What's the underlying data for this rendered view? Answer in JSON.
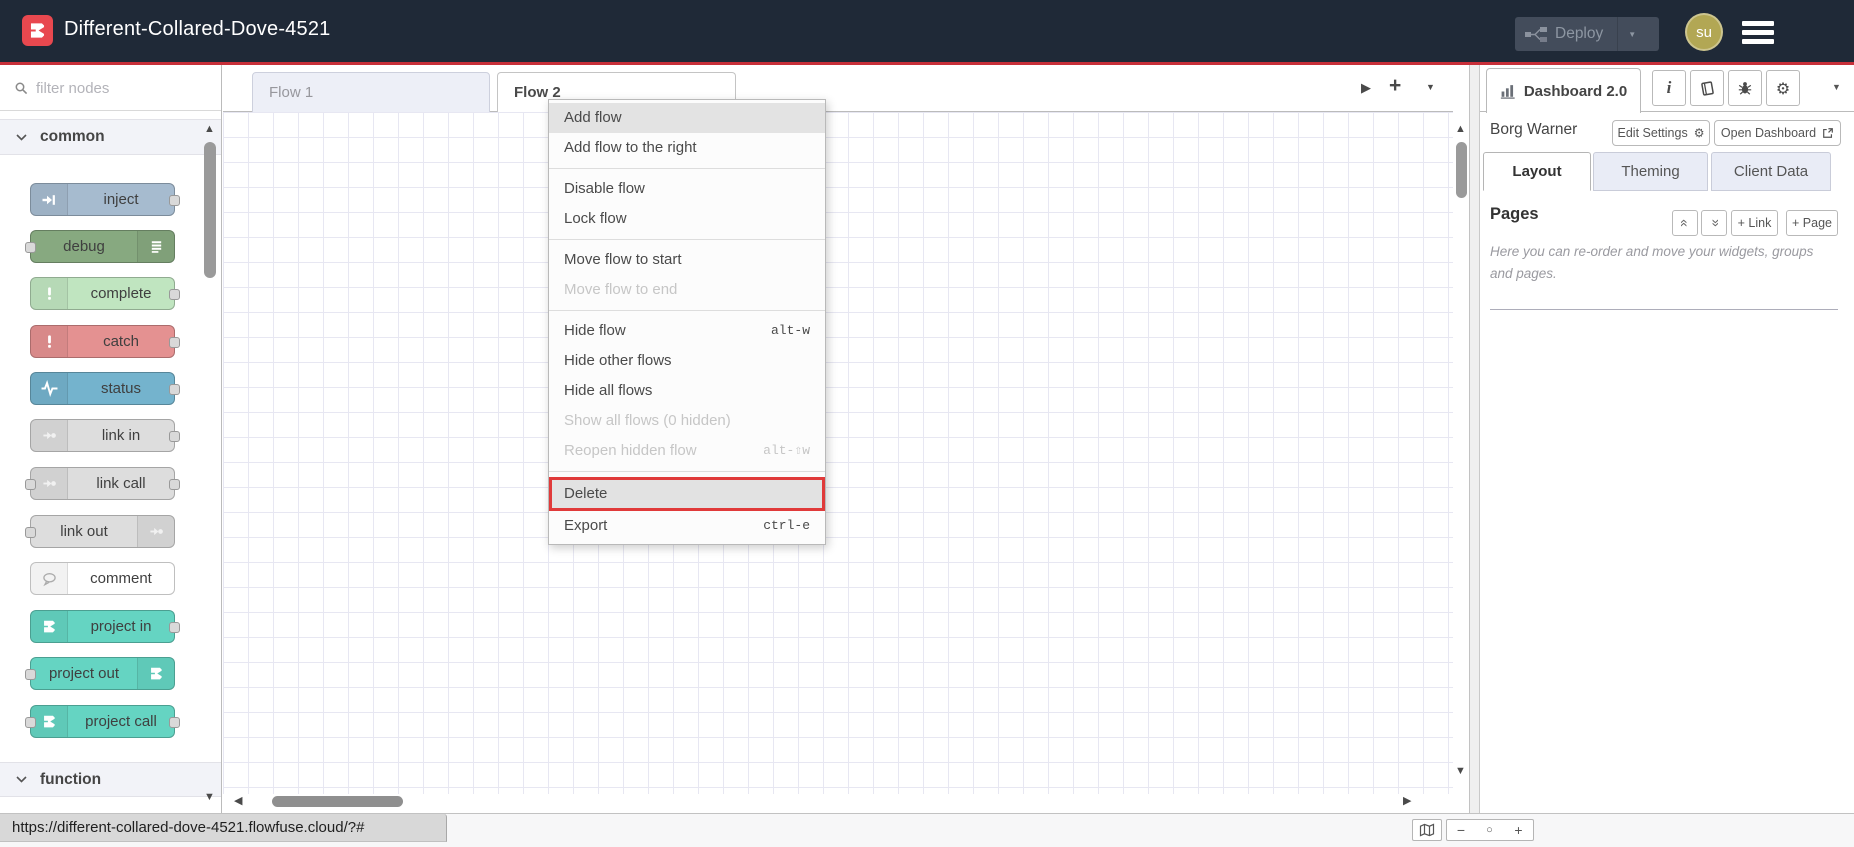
{
  "header": {
    "title": "Different-Collared-Dove-4521",
    "deploy_label": "Deploy",
    "avatar_initials": "su",
    "brand_red": "#e8484f",
    "accent_line": "#c72f39",
    "bar_color": "#1f2937"
  },
  "palette": {
    "filter_placeholder": "filter nodes",
    "categories": [
      {
        "label": "common"
      },
      {
        "label": "function"
      }
    ],
    "nodes": [
      {
        "label": "inject",
        "color": "#a6bbcf",
        "icon": "inject-arrow-icon",
        "icon_side": "left",
        "port_left": false,
        "port_right": true
      },
      {
        "label": "debug",
        "color": "#87a980",
        "icon": "debug-lines-icon",
        "icon_side": "right",
        "port_left": true,
        "port_right": false
      },
      {
        "label": "complete",
        "color": "#c0e5c0",
        "icon": "exclamation-icon",
        "icon_side": "left",
        "port_left": false,
        "port_right": true
      },
      {
        "label": "catch",
        "color": "#e49191",
        "icon": "exclamation-icon",
        "icon_side": "left",
        "port_left": false,
        "port_right": true
      },
      {
        "label": "status",
        "color": "#74b3cd",
        "icon": "status-pulse-icon",
        "icon_side": "left",
        "port_left": false,
        "port_right": true
      },
      {
        "label": "link in",
        "color": "#dddddd",
        "icon": "link-icon",
        "icon_side": "left",
        "port_left": false,
        "port_right": true
      },
      {
        "label": "link call",
        "color": "#dddddd",
        "icon": "link-icon",
        "icon_side": "left",
        "port_left": true,
        "port_right": true
      },
      {
        "label": "link out",
        "color": "#dddddd",
        "icon": "link-icon",
        "icon_side": "right",
        "port_left": true,
        "port_right": false
      },
      {
        "label": "comment",
        "color": "#ffffff",
        "icon": "comment-bubble-icon",
        "icon_side": "left",
        "port_left": false,
        "port_right": false
      },
      {
        "label": "project in",
        "color": "#65d4c2",
        "icon": "project-merge-icon",
        "icon_side": "left",
        "port_left": false,
        "port_right": true
      },
      {
        "label": "project out",
        "color": "#65d4c2",
        "icon": "project-merge-icon",
        "icon_side": "right",
        "port_left": true,
        "port_right": false
      },
      {
        "label": "project call",
        "color": "#65d4c2",
        "icon": "project-merge-icon",
        "icon_side": "left",
        "port_left": true,
        "port_right": true
      }
    ]
  },
  "workspace": {
    "tabs": [
      {
        "label": "Flow 1",
        "active": false
      },
      {
        "label": "Flow 2",
        "active": true
      }
    ]
  },
  "context_menu": {
    "items": [
      {
        "label": "Add flow",
        "state": "hover"
      },
      {
        "label": "Add flow to the right"
      },
      {
        "sep": true
      },
      {
        "label": "Disable flow"
      },
      {
        "label": "Lock flow"
      },
      {
        "sep": true
      },
      {
        "label": "Move flow to start"
      },
      {
        "label": "Move flow to end",
        "disabled": true
      },
      {
        "sep": true
      },
      {
        "label": "Hide flow",
        "shortcut": "alt-w"
      },
      {
        "label": "Hide other flows"
      },
      {
        "label": "Hide all flows"
      },
      {
        "label": "Show all flows (0 hidden)",
        "disabled": true
      },
      {
        "label": "Reopen hidden flow",
        "shortcut": "alt-⇧w",
        "disabled": true
      },
      {
        "sep": true
      },
      {
        "label": "Delete",
        "state": "highlight"
      },
      {
        "label": "Export",
        "shortcut": "ctrl-e"
      }
    ],
    "highlight_color": "#e03a3a"
  },
  "sidebar": {
    "active_panel_label": "Dashboard 2.0",
    "dashboard_name": "Borg Warner",
    "edit_settings_label": "Edit Settings",
    "open_dashboard_label": "Open Dashboard",
    "tabs": [
      {
        "label": "Layout",
        "active": true
      },
      {
        "label": "Theming",
        "active": false
      },
      {
        "label": "Client Data",
        "active": false
      }
    ],
    "pages": {
      "heading": "Pages",
      "link_button": "+ Link",
      "page_button": "+ Page",
      "help_text": "Here you can re-order and move your widgets, groups and pages."
    }
  },
  "footer": {
    "url_preview": "https://different-collared-dove-4521.flowfuse.cloud/?#",
    "zoom_out_label": "−",
    "zoom_reset_label": "○",
    "zoom_in_label": "+"
  }
}
